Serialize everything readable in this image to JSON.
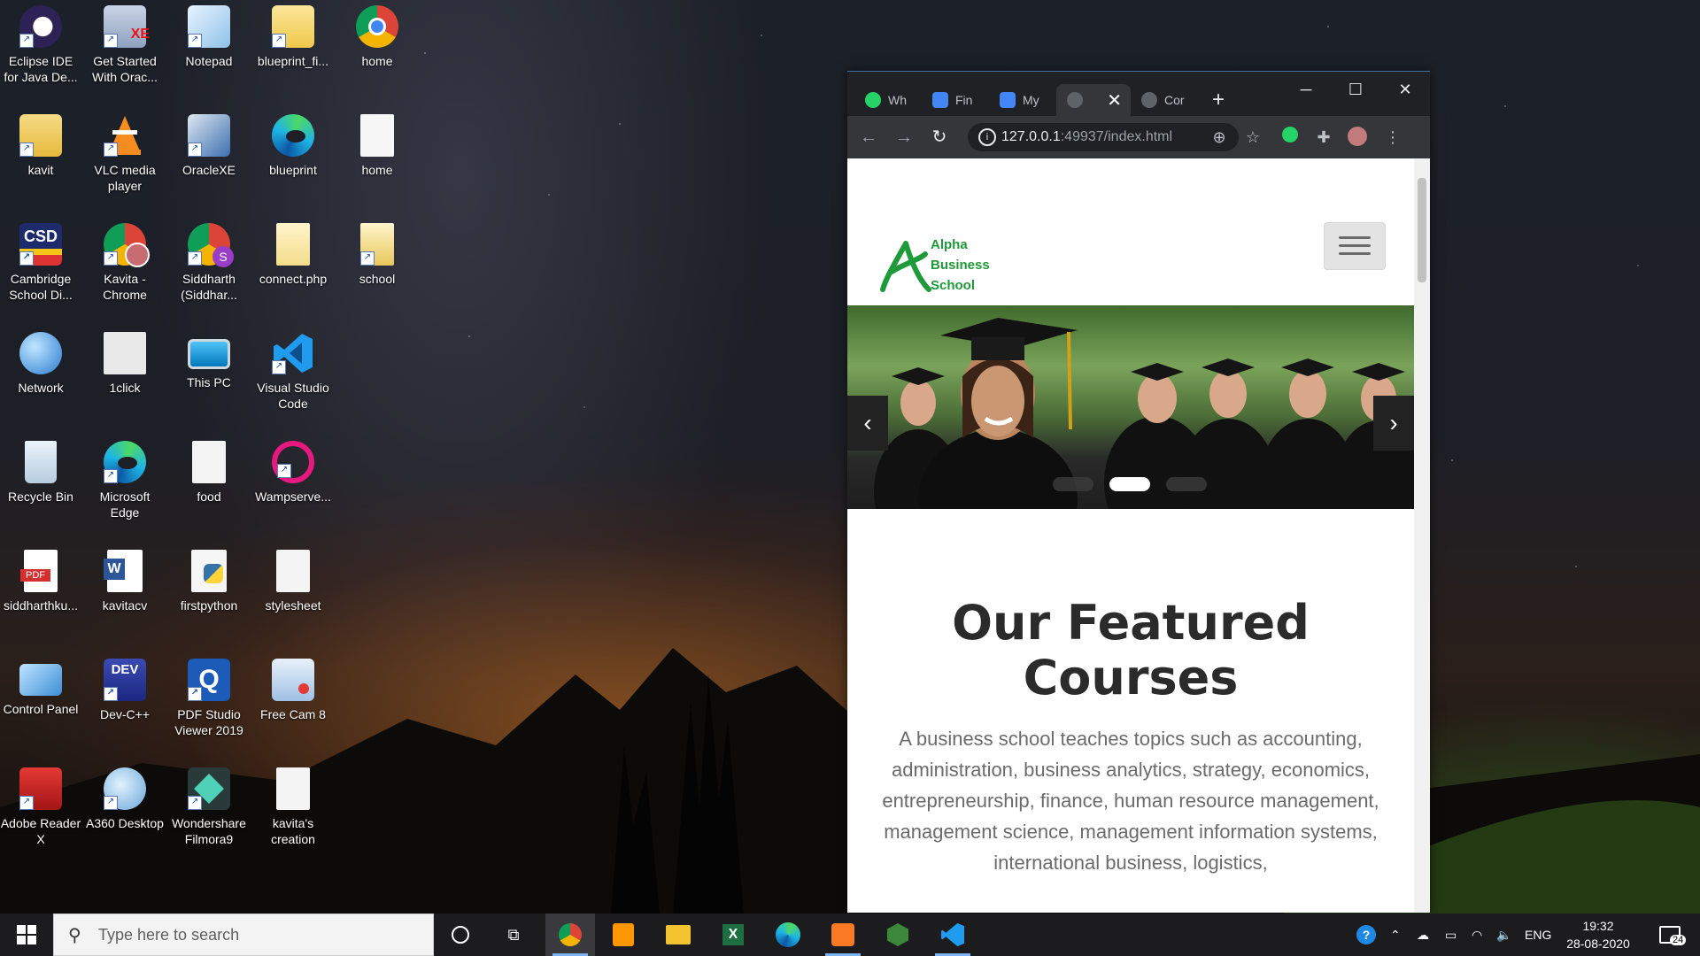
{
  "desktop": {
    "icons": [
      {
        "label": "Eclipse IDE for Java De...",
        "icon": "eclipse-icon"
      },
      {
        "label": "Get Started With Orac...",
        "icon": "oracle-xe-icon"
      },
      {
        "label": "Notepad",
        "icon": "notepad-icon"
      },
      {
        "label": "blueprint_fi...",
        "icon": "folder-icon"
      },
      {
        "label": "home",
        "icon": "chrome-icon"
      },
      {
        "label": "kavit",
        "icon": "user-folder-icon"
      },
      {
        "label": "VLC media player",
        "icon": "vlc-icon"
      },
      {
        "label": "OracleXE",
        "icon": "oracle-setup-icon"
      },
      {
        "label": "blueprint",
        "icon": "edge-icon"
      },
      {
        "label": "home",
        "icon": "file-icon"
      },
      {
        "label": "Cambridge School Di...",
        "icon": "csd-icon"
      },
      {
        "label": "Kavita - Chrome",
        "icon": "chrome-profile-icon"
      },
      {
        "label": "Siddharth (Siddhar...",
        "icon": "chrome-profile-icon"
      },
      {
        "label": "connect.php",
        "icon": "file-icon"
      },
      {
        "label": "school",
        "icon": "document-icon"
      },
      {
        "label": "Network",
        "icon": "network-icon"
      },
      {
        "label": "1click",
        "icon": "settings-file-icon"
      },
      {
        "label": "This PC",
        "icon": "computer-icon"
      },
      {
        "label": "Visual Studio Code",
        "icon": "vscode-icon"
      },
      {
        "label": "Recycle Bin",
        "icon": "recycle-bin-icon"
      },
      {
        "label": "Microsoft Edge",
        "icon": "edge-icon"
      },
      {
        "label": "food",
        "icon": "settings-file-icon"
      },
      {
        "label": "Wampserve...",
        "icon": "wampserver-icon"
      },
      {
        "label": "siddharthku...",
        "icon": "pdf-icon"
      },
      {
        "label": "kavitacv",
        "icon": "word-icon"
      },
      {
        "label": "firstpython",
        "icon": "python-icon"
      },
      {
        "label": "stylesheet",
        "icon": "settings-file-icon"
      },
      {
        "label": "Control Panel",
        "icon": "control-panel-icon"
      },
      {
        "label": "Dev-C++",
        "icon": "devcpp-icon"
      },
      {
        "label": "PDF Studio Viewer 2019",
        "icon": "pdf-studio-icon"
      },
      {
        "label": "Free Cam 8",
        "icon": "freecam-icon"
      },
      {
        "label": "Adobe Reader X",
        "icon": "adobe-reader-icon"
      },
      {
        "label": "A360 Desktop",
        "icon": "a360-icon"
      },
      {
        "label": "Wondershare Filmora9",
        "icon": "filmora-icon"
      },
      {
        "label": "kavita's creation",
        "icon": "settings-file-icon"
      }
    ]
  },
  "browser": {
    "tabs": [
      {
        "label": "Wh",
        "icon": "whatsapp-icon"
      },
      {
        "label": "Fin",
        "icon": "docs-icon"
      },
      {
        "label": "My",
        "icon": "docs-icon"
      },
      {
        "label": "",
        "icon": "globe-icon",
        "active": true
      },
      {
        "label": "Cor",
        "icon": "globe-icon"
      }
    ],
    "new_tab_label": "+",
    "url_host": "127.0.0.1",
    "url_rest": ":49937/index.html",
    "page": {
      "logo_lines": [
        "Alpha",
        "Business",
        "School"
      ],
      "heading": "Our Featured Courses",
      "paragraph": "A business school teaches topics such as accounting, administration, business analytics, strategy, economics, entrepreneurship, finance, human resource management, management science, management information systems, international business, logistics,",
      "carousel_slide_count": 3,
      "carousel_active_slide": 2
    }
  },
  "taskbar": {
    "search_placeholder": "Type here to search",
    "apps": [
      "chrome-icon",
      "sublime-icon",
      "file-explorer-icon",
      "excel-icon",
      "edge-icon",
      "xampp-icon",
      "node-icon",
      "vscode-icon"
    ],
    "language": "ENG",
    "time": "19:32",
    "date": "28-08-2020",
    "notifications": "24"
  },
  "colors": {
    "accent": "#7ab4f5",
    "logo_green": "#1f9a3a",
    "chrome_dark": "#202124"
  }
}
